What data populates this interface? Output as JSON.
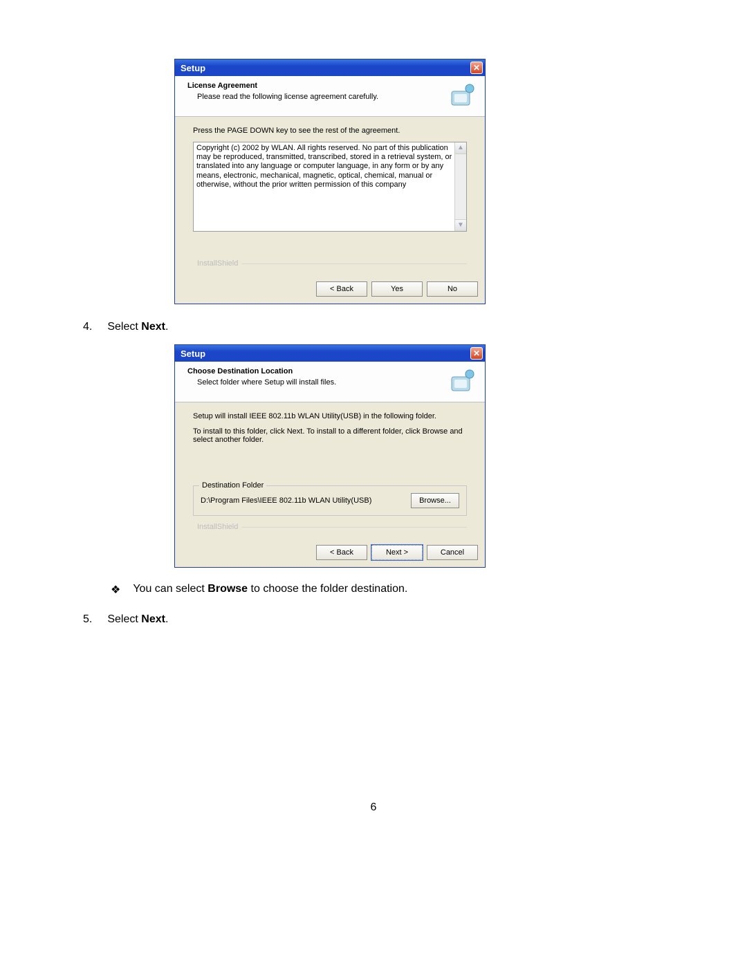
{
  "dialog1": {
    "title": "Setup",
    "header_title": "License Agreement",
    "header_sub": "Please read the following license agreement carefully.",
    "instr": "Press the PAGE DOWN key to see the rest of the agreement.",
    "license_text": "Copyright (c) 2002 by WLAN. All rights reserved. No part of this publication may be reproduced, transmitted, transcribed, stored in a retrieval system, or translated into any language or computer language, in any form or by any means, electronic, mechanical, magnetic, optical, chemical, manual or otherwise, without the prior written permission of this company",
    "brand": "InstallShield",
    "btn_back": "< Back",
    "btn_yes": "Yes",
    "btn_no": "No"
  },
  "step4_num": "4.",
  "step4_text_a": "Select ",
  "step4_text_b": "Next",
  "step4_text_c": ".",
  "dialog2": {
    "title": "Setup",
    "header_title": "Choose Destination Location",
    "header_sub": "Select folder where Setup will install files.",
    "line1": "Setup will install IEEE 802.11b WLAN Utility(USB) in the following folder.",
    "line2": "To install to this folder, click Next. To install to a different folder, click Browse and select another folder.",
    "dest_legend": "Destination Folder",
    "dest_path": "D:\\Program Files\\IEEE 802.11b WLAN Utility(USB)",
    "browse": "Browse...",
    "brand": "InstallShield",
    "btn_back": "< Back",
    "btn_next": "Next >",
    "btn_cancel": "Cancel"
  },
  "bullet_mark": "❖",
  "bullet_text_a": "You can select ",
  "bullet_text_b": "Browse",
  "bullet_text_c": " to choose the folder destination.",
  "step5_num": "5.",
  "step5_text_a": "Select ",
  "step5_text_b": "Next",
  "step5_text_c": ".",
  "page_number": "6"
}
